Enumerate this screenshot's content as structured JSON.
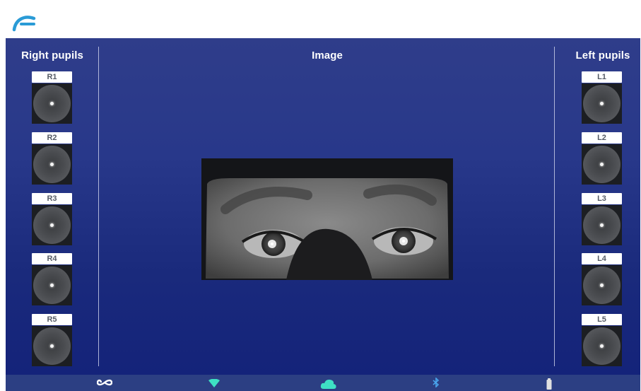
{
  "header": {
    "logo": "app-logo-arc-icon"
  },
  "columns": {
    "right_title": "Right pupils",
    "center_title": "Image",
    "left_title": "Left pupils"
  },
  "right_pupils": [
    {
      "label": "R1"
    },
    {
      "label": "R2"
    },
    {
      "label": "R3"
    },
    {
      "label": "R4"
    },
    {
      "label": "R5"
    }
  ],
  "left_pupils": [
    {
      "label": "L1"
    },
    {
      "label": "L2"
    },
    {
      "label": "L3"
    },
    {
      "label": "L4"
    },
    {
      "label": "L5"
    }
  ],
  "status_bar": {
    "icons": [
      "infinity-icon",
      "wifi-icon",
      "cloud-icon",
      "bluetooth-icon",
      "battery-icon"
    ],
    "colors": {
      "infinity": "#ffffff",
      "wifi": "#3ee0c4",
      "cloud": "#3ee0c4",
      "bluetooth": "#4aa8f0",
      "battery": "#e0e0e0"
    }
  },
  "colors": {
    "accent": "#2a9bd6",
    "panel_top": "#2f3d8a",
    "panel_bottom": "#14237a"
  }
}
